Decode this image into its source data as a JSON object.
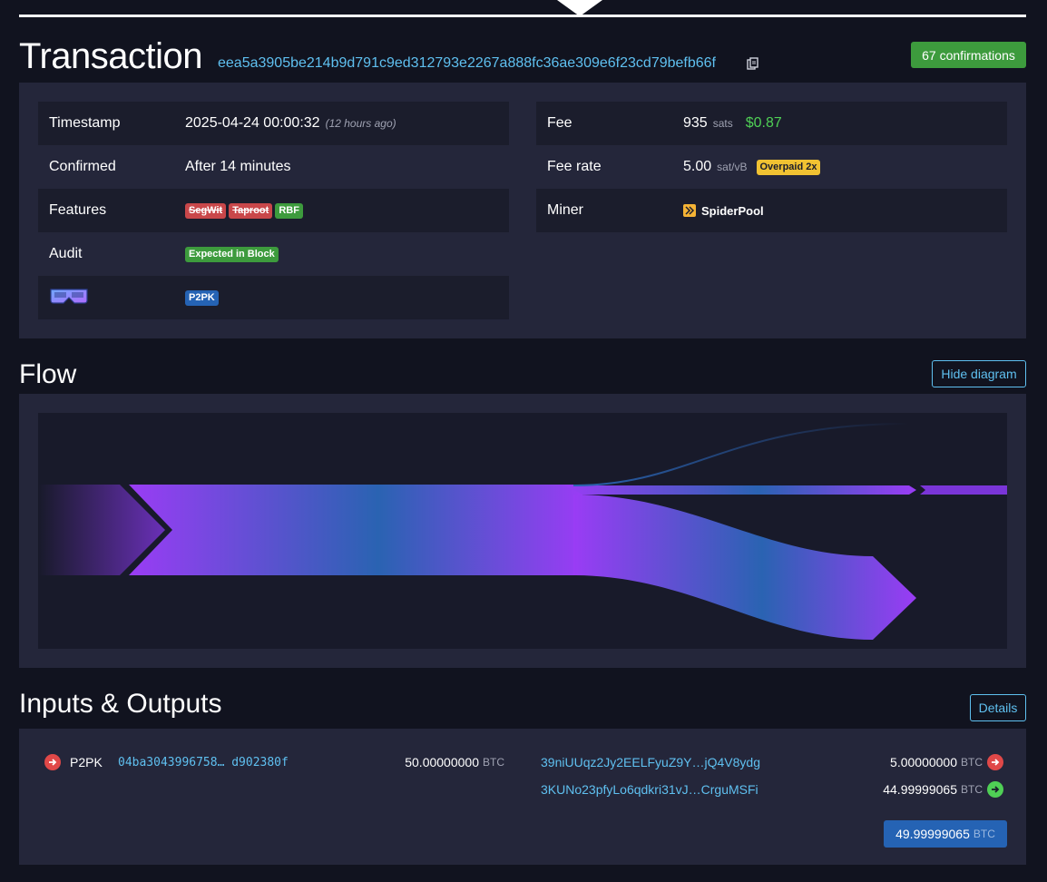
{
  "header": {
    "title": "Transaction",
    "txid": "eea5a3905be214b9d791c9ed312793e2267a888fc36ae309e6f23cd79befb66f",
    "confirmations": "67 confirmations"
  },
  "details": {
    "left": {
      "timestamp": {
        "label": "Timestamp",
        "value": "2025-04-24 00:00:32",
        "relative": "(12 hours ago)"
      },
      "confirmed": {
        "label": "Confirmed",
        "value": "After 14 minutes"
      },
      "features": {
        "label": "Features",
        "tags": [
          "SegWit",
          "Taproot",
          "RBF"
        ]
      },
      "audit": {
        "label": "Audit",
        "value": "Expected in Block"
      },
      "script": {
        "icon": "goggles-icon",
        "value": "P2PK"
      }
    },
    "right": {
      "fee": {
        "label": "Fee",
        "value": "935",
        "unit": "sats",
        "fiat": "$0.87"
      },
      "fee_rate": {
        "label": "Fee rate",
        "value": "5.00",
        "unit": "sat/vB",
        "badge": "Overpaid 2x"
      },
      "miner": {
        "label": "Miner",
        "value": "SpiderPool"
      }
    }
  },
  "flow": {
    "title": "Flow",
    "hide_button": "Hide diagram"
  },
  "io": {
    "title": "Inputs & Outputs",
    "details_button": "Details",
    "inputs": [
      {
        "type": "P2PK",
        "address": "04ba3043996758… d902380f",
        "amount": "50.00000000",
        "unit": "BTC"
      }
    ],
    "outputs": [
      {
        "address": "39niUUqz2Jy2EELFyuZ9Y…jQ4V8ydg",
        "amount": "5.00000000",
        "unit": "BTC",
        "status": "spent"
      },
      {
        "address": "3KUNo23pfyLo6qdkri31vJ…CrguMSFi",
        "amount": "44.99999065",
        "unit": "BTC",
        "status": "unspent"
      }
    ],
    "total": {
      "amount": "49.99999065",
      "unit": "BTC"
    }
  },
  "colors": {
    "background": "#11131f",
    "panel": "#24263a",
    "link": "#5fc0f0",
    "success": "#3d9b3d",
    "danger": "#c9474a",
    "flow_purple": "#9a3cf5",
    "flow_blue": "#2a63b2"
  }
}
